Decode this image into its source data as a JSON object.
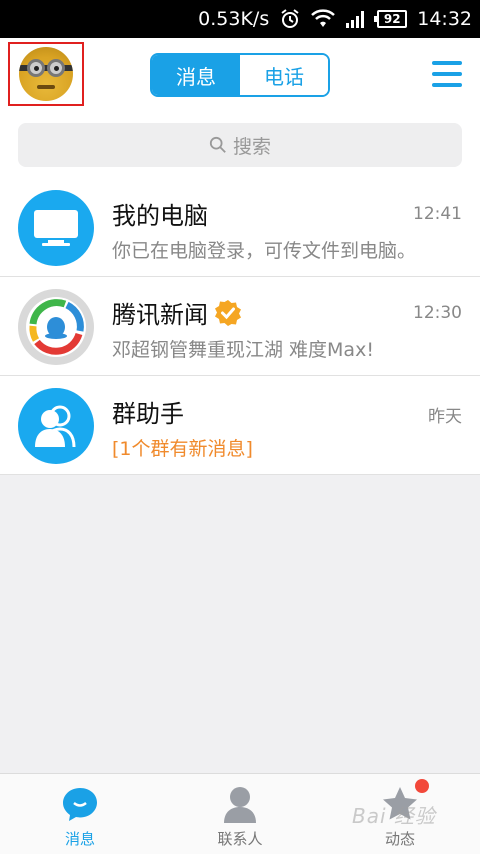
{
  "status_bar": {
    "speed": "0.53K/s",
    "battery": "92",
    "time": "14:32"
  },
  "header": {
    "tabs": [
      {
        "label": "消息",
        "active": true
      },
      {
        "label": "电话",
        "active": false
      }
    ]
  },
  "search": {
    "placeholder": "搜索"
  },
  "conversations": [
    {
      "title": "我的电脑",
      "time": "12:41",
      "subtitle": "你已在电脑登录，可传文件到电脑。",
      "icon": "monitor-icon",
      "color": "#1aa9ef"
    },
    {
      "title": "腾讯新闻",
      "time": "12:30",
      "subtitle": "邓超钢管舞重现江湖 难度Max!",
      "icon": "tencent-news-icon",
      "verified": true
    },
    {
      "title": "群助手",
      "time": "昨天",
      "subtitle": "[1个群有新消息]",
      "icon": "group-helper-icon",
      "color": "#1aa9ef",
      "subtitle_color": "#f08a2c"
    }
  ],
  "tab_bar": {
    "tabs": [
      {
        "label": "消息",
        "icon": "message-bubble-icon",
        "active": true
      },
      {
        "label": "联系人",
        "icon": "contacts-icon",
        "active": false
      },
      {
        "label": "动态",
        "icon": "star-icon",
        "active": false,
        "badge": true
      }
    ]
  },
  "watermark": "Bai 经验",
  "colors": {
    "accent": "#1aa1e6",
    "highlight_border": "#e0201f",
    "badge_red": "#f2483a"
  }
}
